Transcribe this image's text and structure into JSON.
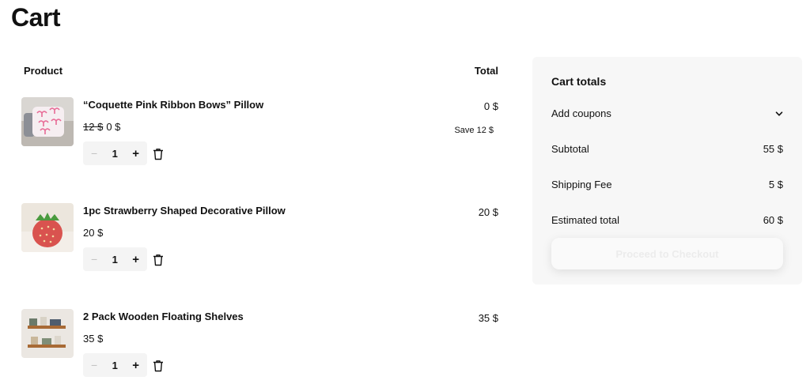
{
  "page": {
    "title": "Cart"
  },
  "table": {
    "product_header": "Product",
    "total_header": "Total"
  },
  "items": [
    {
      "name": "“Coquette Pink Ribbon Bows” Pillow",
      "old_price": "12 $",
      "price": "0 $",
      "quantity": "1",
      "total": "0 $",
      "save": "Save 12 $",
      "image": "pink-bow-pillow-image"
    },
    {
      "name": "1pc Strawberry Shaped Decorative Pillow",
      "price": "20 $",
      "quantity": "1",
      "total": "20 $",
      "image": "strawberry-pillow-image"
    },
    {
      "name": "2 Pack Wooden Floating Shelves",
      "price": "35 $",
      "quantity": "1",
      "total": "35 $",
      "image": "wooden-shelves-image"
    }
  ],
  "qty_controls": {
    "minus": "−",
    "plus": "+"
  },
  "totals": {
    "title": "Cart totals",
    "coupon_label": "Add coupons",
    "subtotal_label": "Subtotal",
    "subtotal_value": "55 $",
    "shipping_label": "Shipping Fee",
    "shipping_value": "5 $",
    "estimated_label": "Estimated total",
    "estimated_value": "60 $",
    "checkout_label": "Proceed to Checkout"
  },
  "colors": {
    "panel_bg": "#f7f7f7",
    "stepper_bg": "#f4f4f4",
    "text": "#111111",
    "disabled_text": "#ececec"
  }
}
